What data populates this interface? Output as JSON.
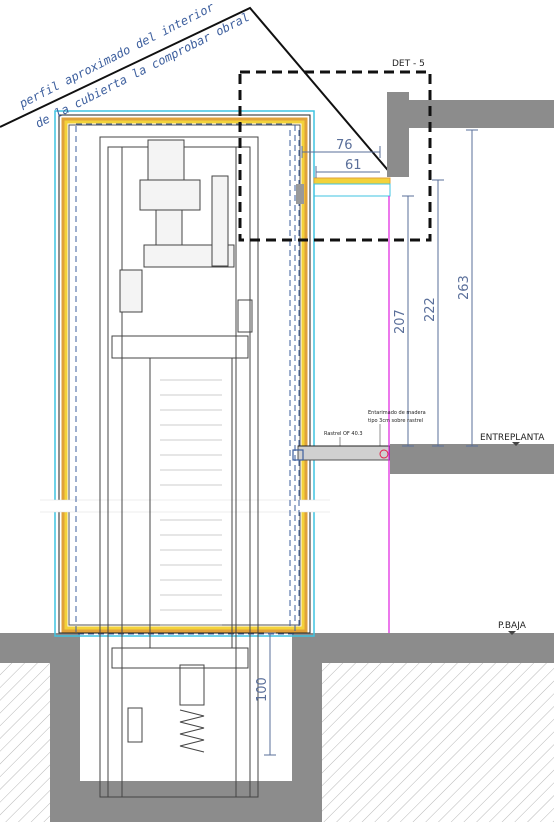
{
  "drawing": {
    "note_line1": "perfil aproximado del interior",
    "note_line2": "de la cubierta la comprobar obral",
    "detail_label": "DET - 5",
    "level_upper": "ENTREPLANTA",
    "level_ground": "P.BAJA",
    "annotation_restrel": "Rastrel OF 40.3",
    "annotation_entarimado_1": "Entarimado de madera",
    "annotation_entarimado_2": "tipo 3cm sobre rastrel"
  },
  "dimensions": {
    "d76": "76",
    "d61": "61",
    "d207": "207",
    "d222": "222",
    "d263": "263",
    "d100": "100"
  },
  "colors": {
    "wall_gray": "#8c8c8c",
    "insulation_yellow": "#f3d23a",
    "insulation_orange": "#e0a23a",
    "dim_blue": "#5a6f9a",
    "dash_blue": "#3d5f9e",
    "cable_magenta": "#e020e0",
    "cyan": "#3fc3e0"
  }
}
